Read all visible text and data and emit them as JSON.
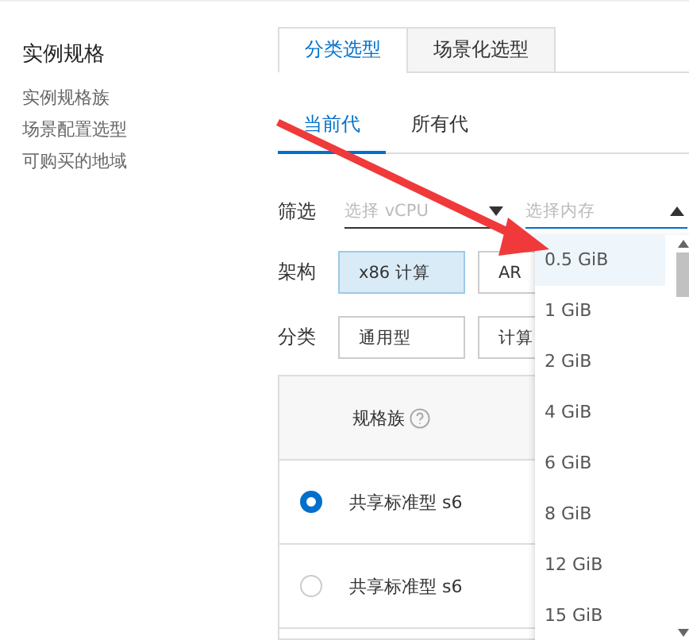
{
  "sidebar": {
    "title": "实例规格",
    "items": [
      "实例规格族",
      "场景配置选型",
      "可购买的地域"
    ]
  },
  "mode_tabs": [
    {
      "label": "分类选型",
      "selected": true
    },
    {
      "label": "场景化选型",
      "selected": false
    }
  ],
  "generation_tabs": [
    {
      "label": "当前代",
      "selected": true
    },
    {
      "label": "所有代",
      "selected": false
    }
  ],
  "filter": {
    "label": "筛选",
    "vcpu": {
      "placeholder": "选择 vCPU",
      "expanded": false
    },
    "memory": {
      "placeholder": "选择内存",
      "expanded": true
    }
  },
  "architecture": {
    "label": "架构",
    "options": [
      {
        "label": "x86 计算",
        "selected": true
      },
      {
        "label": "AR",
        "selected": false
      }
    ]
  },
  "category": {
    "label": "分类",
    "options": [
      {
        "label": "通用型",
        "selected": false
      },
      {
        "label": "计算",
        "selected": false
      }
    ]
  },
  "table": {
    "columns": [
      "规格族"
    ],
    "rows": [
      {
        "name": "共享标准型 s6",
        "selected": true
      },
      {
        "name": "共享标准型 s6",
        "selected": false
      }
    ]
  },
  "memory_dropdown": [
    {
      "label": "0.5 GiB",
      "selected": true
    },
    {
      "label": "1 GiB",
      "selected": false
    },
    {
      "label": "2 GiB",
      "selected": false
    },
    {
      "label": "4 GiB",
      "selected": false
    },
    {
      "label": "6 GiB",
      "selected": false
    },
    {
      "label": "8 GiB",
      "selected": false
    },
    {
      "label": "12 GiB",
      "selected": false
    },
    {
      "label": "15 GiB",
      "selected": false
    }
  ],
  "annotation": {
    "kind": "arrow"
  }
}
